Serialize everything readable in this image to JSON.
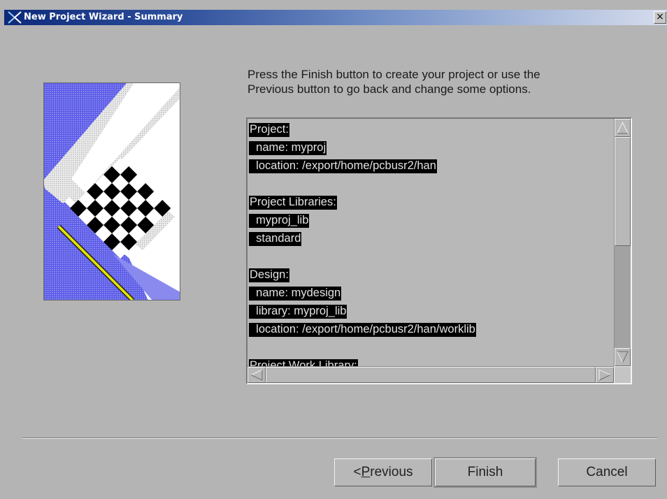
{
  "window": {
    "title": "New Project Wizard - Summary",
    "close_glyph": "×",
    "app_icon": "x-logo-icon"
  },
  "instructions": {
    "line1": "Press the Finish button to create your project or use the",
    "line2": "Previous button to go back and change some options."
  },
  "summary": {
    "lines": [
      {
        "indent": "",
        "text": "Project:"
      },
      {
        "indent": "  ",
        "text": "name: myproj"
      },
      {
        "indent": "  ",
        "text": "location: /export/home/pcbusr2/han"
      },
      {
        "indent": "",
        "text": ""
      },
      {
        "indent": "",
        "text": "Project Libraries:"
      },
      {
        "indent": "  ",
        "text": "myproj_lib"
      },
      {
        "indent": "  ",
        "text": "standard"
      },
      {
        "indent": "",
        "text": ""
      },
      {
        "indent": "",
        "text": "Design:"
      },
      {
        "indent": "  ",
        "text": "name: mydesign"
      },
      {
        "indent": "  ",
        "text": "library: myproj_lib"
      },
      {
        "indent": "  ",
        "text": "location: /export/home/pcbusr2/han/worklib"
      },
      {
        "indent": "",
        "text": ""
      },
      {
        "indent": "",
        "text": "Project Work Library:"
      }
    ]
  },
  "buttons": {
    "previous_prefix": "< ",
    "previous_mnemonic": "P",
    "previous_rest": "revious",
    "finish": "Finish",
    "cancel": "Cancel"
  },
  "scroll": {
    "vertical_position": 0,
    "horizontal_position": 0
  },
  "colors": {
    "window_bg": "#b4b4b4",
    "title_gradient_start": "#0c2a7a",
    "title_gradient_end": "#d6dced",
    "selection_bg": "#000000",
    "selection_fg": "#e2e2e2",
    "graphic_blue": "#6666ee",
    "graphic_yellow": "#e0e000"
  }
}
